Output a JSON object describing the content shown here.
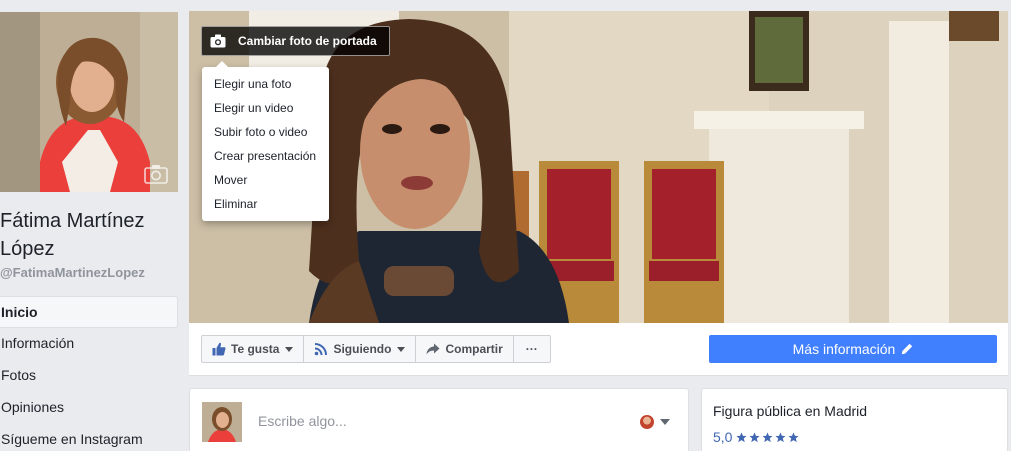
{
  "profile": {
    "name": "Fátima Martínez López",
    "handle": "@FatimaMartinezLopez"
  },
  "nav": {
    "items": [
      {
        "label": "Inicio",
        "active": true
      },
      {
        "label": "Información",
        "active": false
      },
      {
        "label": "Fotos",
        "active": false
      },
      {
        "label": "Opiniones",
        "active": false
      },
      {
        "label": "Sígueme en Instagram",
        "active": false
      }
    ]
  },
  "cover": {
    "change_button_label": "Cambiar foto de portada",
    "menu": [
      "Elegir una foto",
      "Elegir un video",
      "Subir foto o video",
      "Crear presentación",
      "Mover",
      "Eliminar"
    ]
  },
  "actions": {
    "like_label": "Te gusta",
    "following_label": "Siguiendo",
    "share_label": "Compartir",
    "more_label": "···",
    "more_info_label": "Más información"
  },
  "composer": {
    "placeholder": "Escribe algo..."
  },
  "about": {
    "category": "Figura pública en Madrid",
    "rating_value": "5,0",
    "stars": 5
  },
  "colors": {
    "background": "#e9ebee",
    "primary_button": "#4080ff",
    "rating_text": "#4267b2",
    "star": "#4267b2"
  },
  "icons": {
    "cover_camera": "camera-icon",
    "like": "thumbs-up-icon",
    "following": "rss-icon",
    "share": "share-arrow-icon",
    "more_info": "pencil-icon",
    "profile_camera": "camera-icon"
  }
}
